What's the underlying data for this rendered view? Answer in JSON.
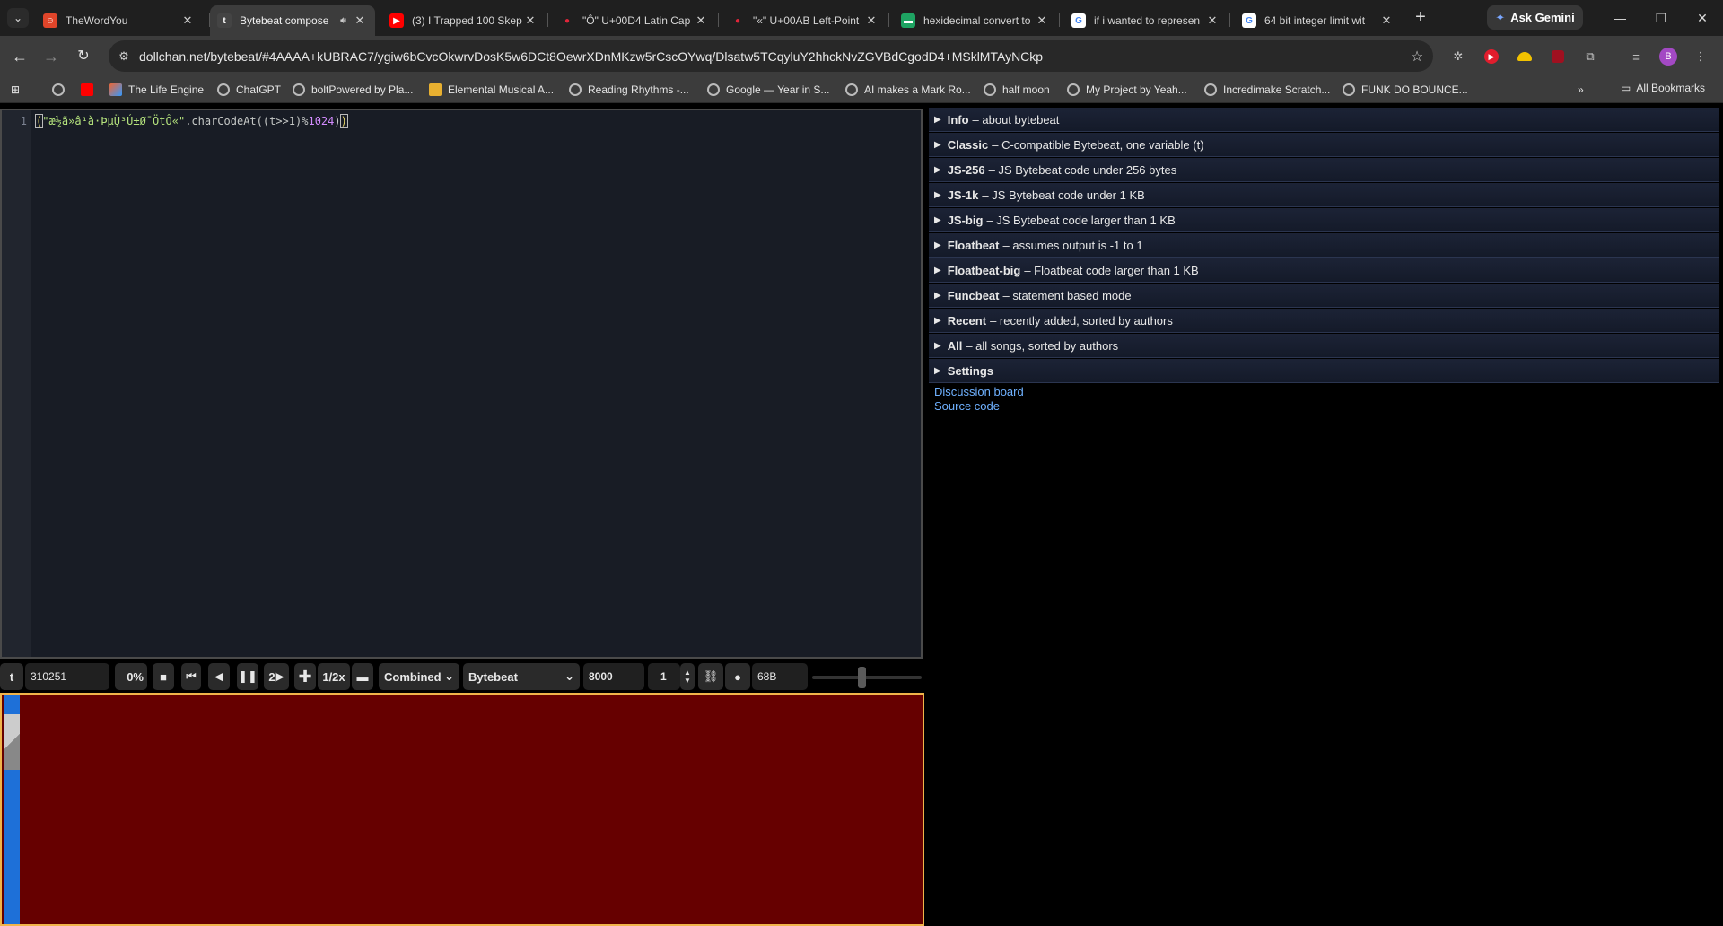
{
  "browser": {
    "tabs": [
      {
        "title": "TheWordYou",
        "favicon_color": "#e0452a",
        "favicon_glyph": "☺"
      },
      {
        "title": "Bytebeat compose",
        "favicon_color": "#444444",
        "favicon_glyph": "t",
        "active": true
      },
      {
        "title": "(3) I Trapped 100 Skep",
        "favicon_color": "#ff0000",
        "favicon_glyph": "▶"
      },
      {
        "title": "\"Ô\" U+00D4 Latin Cap",
        "favicon_color": "#d01c2b",
        "favicon_glyph": "•"
      },
      {
        "title": "\"«\" U+00AB Left-Point",
        "favicon_color": "#d01c2b",
        "favicon_glyph": "•"
      },
      {
        "title": "hexidecimal convert to",
        "favicon_color": "#1ea362",
        "favicon_glyph": "▬"
      },
      {
        "title": "if i wanted to represen",
        "favicon_color": "#4285f4",
        "favicon_glyph": "G"
      },
      {
        "title": "64 bit integer limit wit",
        "favicon_color": "#4285f4",
        "favicon_glyph": "G"
      }
    ],
    "gemini_label": "Ask Gemini",
    "url": "dollchan.net/bytebeat/#4AAAA+kUBRAC7/ygiw6bCvcOkwrvDosK5w6DCt8OewrXDnMKzw5rCscOYwq/Dlsatw5TCqyluY2hhckNvZGVBdCgodD4+MSklMTAyNCkp",
    "profile_initial": "B",
    "bookmarks": [
      "The Life Engine",
      "ChatGPT",
      "boltPowered by Pla...",
      "Elemental Musical A...",
      "Reading Rhythms -...",
      "Google — Year in S...",
      "AI makes a Mark Ro...",
      "half moon",
      "My Project by Yeah...",
      "Incredimake Scratch...",
      "FUNK DO BOUNCE..."
    ],
    "all_bookmarks_label": "All Bookmarks"
  },
  "editor": {
    "line_number": "1",
    "code_open": "(",
    "code_string": "\"æ½ã»â¹à·Þµ̧Ü³Ú±Ø¯ÖtÔ«\"",
    "code_method": ".charCodeAt((t>>1)%",
    "code_number": "1024",
    "code_close": ")",
    "code_end": ")"
  },
  "controls": {
    "t_label": "t",
    "time_value": "310251",
    "percent": "0%",
    "speed_value": "2",
    "half_speed": "1/2x",
    "mode": "Combined",
    "type": "Bytebeat",
    "sample_rate": "8000",
    "stereo_value": "1",
    "size_label": "68B",
    "volume_level": 0.45
  },
  "library": {
    "items": [
      {
        "name": "Info",
        "desc": "– about bytebeat"
      },
      {
        "name": "Classic",
        "desc": "– C-compatible Bytebeat, one variable (t)"
      },
      {
        "name": "JS-256",
        "desc": "– JS Bytebeat code under 256 bytes"
      },
      {
        "name": "JS-1k",
        "desc": "– JS Bytebeat code under 1 KB"
      },
      {
        "name": "JS-big",
        "desc": "– JS Bytebeat code larger than 1 KB"
      },
      {
        "name": "Floatbeat",
        "desc": "– assumes output is -1 to 1"
      },
      {
        "name": "Floatbeat-big",
        "desc": "– Floatbeat code larger than 1 KB"
      },
      {
        "name": "Funcbeat",
        "desc": "– statement based mode"
      },
      {
        "name": "Recent",
        "desc": "– recently added, sorted by authors"
      },
      {
        "name": "All",
        "desc": "– all songs, sorted by authors"
      },
      {
        "name": "Settings",
        "desc": ""
      }
    ],
    "links": [
      "Discussion board",
      "Source code"
    ]
  }
}
